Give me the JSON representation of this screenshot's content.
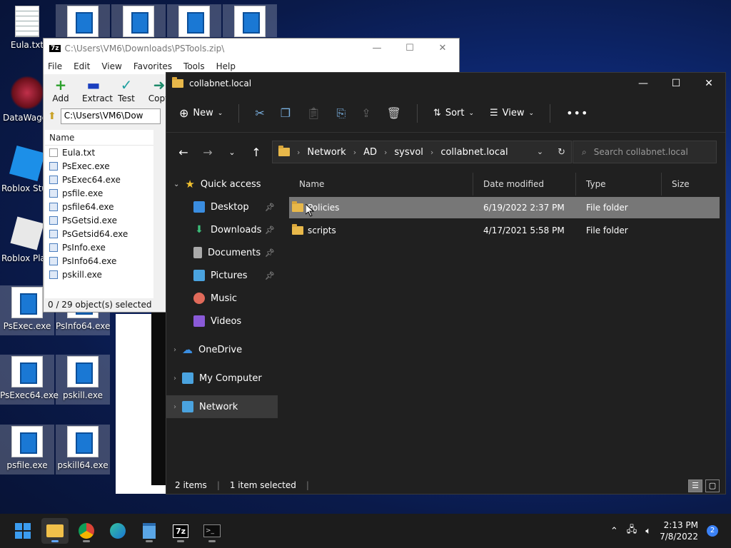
{
  "desktop": {
    "icons": [
      {
        "label": "Eula.txt",
        "type": "txt"
      },
      {
        "label": "DataWago",
        "type": "app"
      },
      {
        "label": "Roblox Stu",
        "type": "app"
      },
      {
        "label": "Roblox Pla",
        "type": "app"
      },
      {
        "label": "PsExec.exe",
        "type": "exe"
      },
      {
        "label": "PsInfo64.exe",
        "type": "exe"
      },
      {
        "label": "PsExec64.exe",
        "type": "exe"
      },
      {
        "label": "pskill.exe",
        "type": "exe"
      },
      {
        "label": "psfile.exe",
        "type": "exe"
      },
      {
        "label": "pskill64.exe",
        "type": "exe"
      }
    ]
  },
  "zip": {
    "title": "C:\\Users\\VM6\\Downloads\\PSTools.zip\\",
    "logo": "7z",
    "menu": [
      "File",
      "Edit",
      "View",
      "Favorites",
      "Tools",
      "Help"
    ],
    "tools": [
      {
        "label": "Add",
        "glyph": "+",
        "color": "#2ca02c"
      },
      {
        "label": "Extract",
        "glyph": "▬",
        "color": "#1a3fbf"
      },
      {
        "label": "Test",
        "glyph": "✓",
        "color": "#20a0a0"
      },
      {
        "label": "Copy",
        "glyph": "➜",
        "color": "#1d8a6a"
      }
    ],
    "address": "C:\\Users\\VM6\\Dow",
    "list_header": "Name",
    "files": [
      "Eula.txt",
      "PsExec.exe",
      "PsExec64.exe",
      "psfile.exe",
      "psfile64.exe",
      "PsGetsid.exe",
      "PsGetsid64.exe",
      "PsInfo.exe",
      "PsInfo64.exe",
      "pskill.exe"
    ],
    "status": "0 / 29 object(s) selected"
  },
  "explorer": {
    "title": "collabnet.local",
    "commands": {
      "new": "New",
      "sort": "Sort",
      "view": "View"
    },
    "breadcrumb": [
      "Network",
      "AD",
      "sysvol",
      "collabnet.local"
    ],
    "search_placeholder": "Search collabnet.local",
    "nav": {
      "quick_access": "Quick access",
      "pinned": [
        "Desktop",
        "Downloads",
        "Documents",
        "Pictures"
      ],
      "others": [
        "Music",
        "Videos"
      ],
      "onedrive": "OneDrive",
      "my_computer": "My Computer",
      "network": "Network"
    },
    "columns": [
      "Name",
      "Date modified",
      "Type",
      "Size"
    ],
    "rows": [
      {
        "name": "Policies",
        "date": "6/19/2022 2:37 PM",
        "type": "File folder",
        "selected": true
      },
      {
        "name": "scripts",
        "date": "4/17/2021 5:58 PM",
        "type": "File folder",
        "selected": false
      }
    ],
    "status": {
      "items": "2 items",
      "selected": "1 item selected"
    }
  },
  "taskbar": {
    "time": "2:13 PM",
    "date": "7/8/2022",
    "notifications": "2",
    "apps": [
      "start",
      "file-explorer",
      "chrome",
      "edge",
      "notepad",
      "7zip",
      "terminal"
    ]
  }
}
